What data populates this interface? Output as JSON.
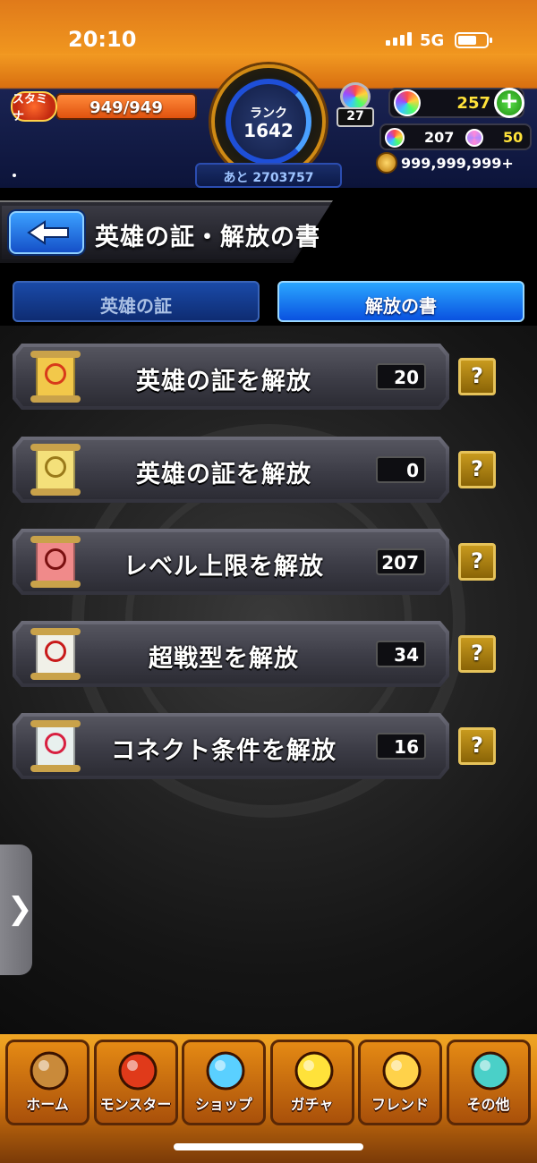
{
  "status_bar": {
    "time": "20:10",
    "network": "5G"
  },
  "header": {
    "stamina_label": "スタミナ",
    "stamina_value": "949/949",
    "stamina_fraction": 1.0,
    "rank_label": "ランク",
    "rank_value": "1642",
    "rank_next": "あと 2703757",
    "orb_stock_count": "27",
    "orbs": "257",
    "orbs_free": "207",
    "orbs_special": "50",
    "gold": "999,999,999+"
  },
  "page": {
    "title": "英雄の証・解放の書"
  },
  "tabs": [
    {
      "label": "英雄の証",
      "active": false
    },
    {
      "label": "解放の書",
      "active": true
    }
  ],
  "items": [
    {
      "label": "英雄の証を解放",
      "count": "20",
      "icon": "gold-scroll-icon",
      "paper": "#f2c84a",
      "mark": "#d83a1a"
    },
    {
      "label": "英雄の証を解放",
      "count": "0",
      "icon": "silver-gold-scroll-icon",
      "paper": "#f4e07a",
      "mark": "#9a7a1a"
    },
    {
      "label": "レベル上限を解放",
      "count": "207",
      "icon": "red-scroll-icon",
      "paper": "#f08a8a",
      "mark": "#7a1010"
    },
    {
      "label": "超戦型を解放",
      "count": "34",
      "icon": "white-scroll-icon",
      "paper": "#f0f0e8",
      "mark": "#c81a1a"
    },
    {
      "label": "コネクト条件を解放",
      "count": "16",
      "icon": "connect-scroll-icon",
      "paper": "#e8f0ee",
      "mark": "#d82040"
    }
  ],
  "help_label": "?",
  "nav": [
    {
      "label": "ホーム",
      "icon": "home-gate-icon",
      "color": "#c98a3a"
    },
    {
      "label": "モンスター",
      "icon": "monster-icon",
      "color": "#e03a1a"
    },
    {
      "label": "ショップ",
      "icon": "rainbow-orb-icon",
      "color": "#5ad0ff"
    },
    {
      "label": "ガチャ",
      "icon": "gacha-egg-icon",
      "color": "#ffe23a"
    },
    {
      "label": "フレンド",
      "icon": "friends-icon",
      "color": "#ffd24a"
    },
    {
      "label": "その他",
      "icon": "other-menu-icon",
      "color": "#4ad0c8"
    }
  ],
  "side_tab_glyph": "❯"
}
